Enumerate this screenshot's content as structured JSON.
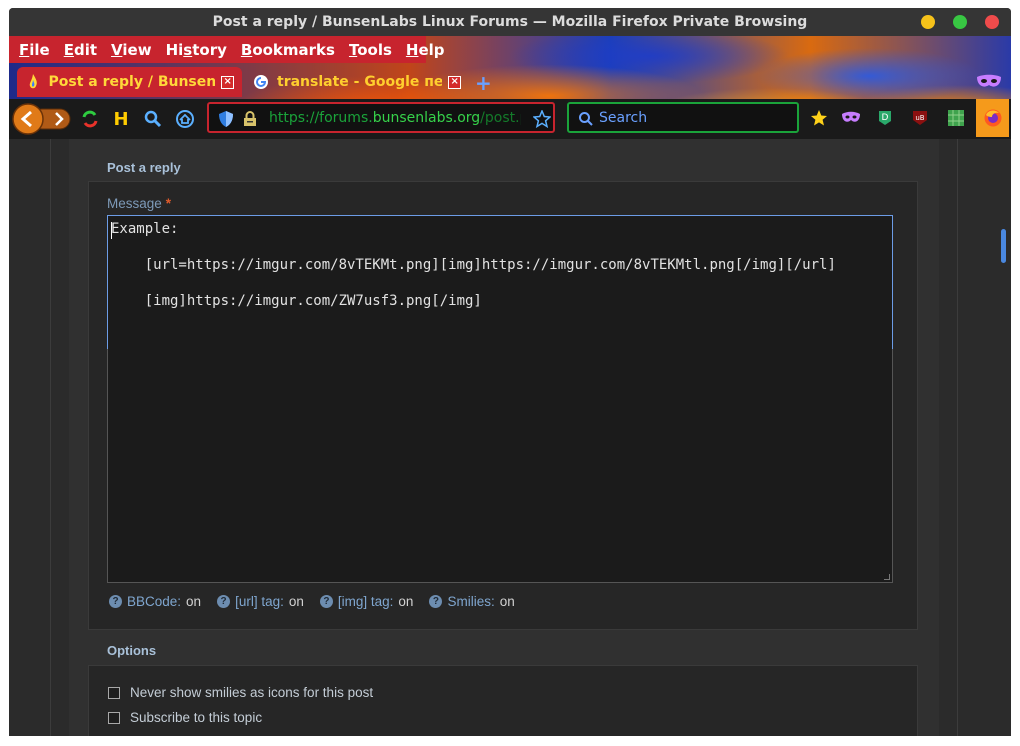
{
  "window": {
    "title": "Post a reply / BunsenLabs Linux Forums — Mozilla Firefox Private Browsing",
    "controls": {
      "minimize_color": "#f6c21a",
      "maximize_color": "#38c743",
      "close_color": "#ef4b4b"
    }
  },
  "menubar": {
    "items": [
      {
        "label": "File",
        "mnemonic": "F",
        "rest": "ile"
      },
      {
        "label": "Edit",
        "mnemonic": "E",
        "rest": "dit"
      },
      {
        "label": "View",
        "mnemonic": "V",
        "rest": "iew"
      },
      {
        "label": "History",
        "pre": "Hi",
        "mnemonic": "s",
        "rest": "tory"
      },
      {
        "label": "Bookmarks",
        "mnemonic": "B",
        "rest": "ookmarks"
      },
      {
        "label": "Tools",
        "mnemonic": "T",
        "rest": "ools"
      },
      {
        "label": "Help",
        "mnemonic": "H",
        "rest": "elp"
      }
    ]
  },
  "tabs": [
    {
      "label": "Post a reply / BunsenLab",
      "favicon": "bunsenlabs-flame-icon",
      "active": true
    },
    {
      "label": "translate - Google переводчик",
      "favicon": "google-icon",
      "active": false
    }
  ],
  "navbar": {
    "url": {
      "prefix": "https://forums.",
      "domain": "bunsenlabs.org",
      "suffix": "/post.php?tid=..."
    },
    "search_placeholder": "Search"
  },
  "form": {
    "section_title": "Post a reply",
    "message_label": "Message",
    "required_marker": "*",
    "message_lines": [
      "Example:",
      "",
      "    [url=https://imgur.com/8vTEKMt.png][img]https://imgur.com/8vTEKMtl.png[/img][/url]",
      "",
      "    [img]https://imgur.com/ZW7usf3.png[/img]"
    ],
    "info": [
      {
        "key": "BBCode:",
        "value": "on"
      },
      {
        "key": "[url] tag:",
        "value": "on"
      },
      {
        "key": "[img] tag:",
        "value": "on"
      },
      {
        "key": "Smilies:",
        "value": "on"
      }
    ],
    "options_title": "Options",
    "options": [
      {
        "label": "Never show smilies as icons for this post",
        "checked": false
      },
      {
        "label": "Subscribe to this topic",
        "checked": false
      }
    ]
  },
  "colors": {
    "accent_red": "#c7242e",
    "link_blue": "#7fa6cf",
    "url_green": "#36d24a",
    "tab_text_yellow": "#ffd83a"
  }
}
